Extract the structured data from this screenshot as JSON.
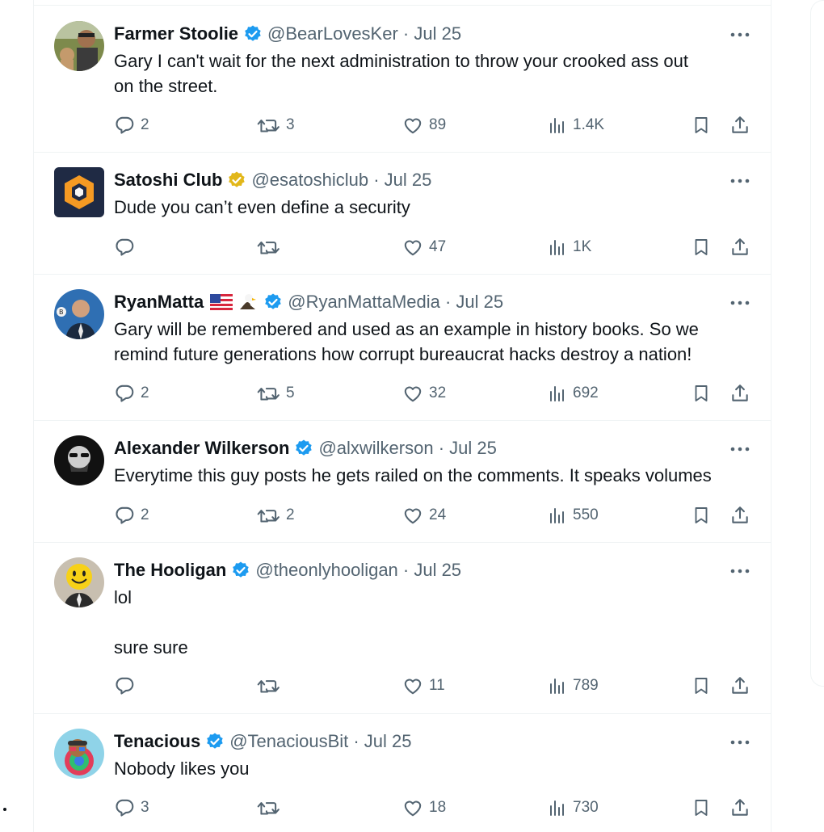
{
  "tweets": [
    {
      "name": "Farmer Stoolie",
      "badge": "blue",
      "flag": "",
      "handle_time": "@BearLovesKer · Jul 25",
      "text": "Gary I can't wait for the next administration to throw your crooked ass out\non the street.",
      "replies": "2",
      "retweets": "3",
      "likes": "89",
      "views": "1.4K"
    },
    {
      "name": "Satoshi Club",
      "badge": "gold",
      "flag": "",
      "handle_time": "@esatoshiclub · Jul 25",
      "text": "Dude you can’t even define a security",
      "replies": "",
      "retweets": "",
      "likes": "47",
      "views": "1K"
    },
    {
      "name": "RyanMatta",
      "badge": "blue",
      "flag": "us-flag-eagle",
      "handle_time": "@RyanMattaMedia · Jul 25",
      "text": "Gary will be remembered and used as an example in history books. So we\nremind future generations how corrupt bureaucrat hacks destroy a nation!",
      "replies": "2",
      "retweets": "5",
      "likes": "32",
      "views": "692"
    },
    {
      "name": "Alexander Wilkerson",
      "badge": "blue",
      "flag": "",
      "handle_time": "@alxwilkerson · Jul 25",
      "text": "Everytime this guy posts he gets railed on the comments. It speaks volumes",
      "replies": "2",
      "retweets": "2",
      "likes": "24",
      "views": "550"
    },
    {
      "name": "The Hooligan",
      "badge": "blue",
      "flag": "",
      "handle_time": "@theonlyhooligan · Jul 25",
      "text": "lol\n\nsure sure",
      "replies": "",
      "retweets": "",
      "likes": "11",
      "views": "789"
    },
    {
      "name": "Tenacious",
      "badge": "blue",
      "flag": "",
      "handle_time": "@TenaciousBit · Jul 25",
      "text": "Nobody likes you",
      "replies": "3",
      "retweets": "",
      "likes": "18",
      "views": "730"
    }
  ],
  "colors": {
    "verified_blue": "#1d9bf0",
    "verified_gold": "#e2b719",
    "text": "#0f1419",
    "secondary": "#536471"
  },
  "icons": [
    "reply-icon",
    "retweet-icon",
    "like-icon",
    "views-icon",
    "bookmark-icon",
    "share-icon",
    "more-icon",
    "verified-badge-icon"
  ]
}
